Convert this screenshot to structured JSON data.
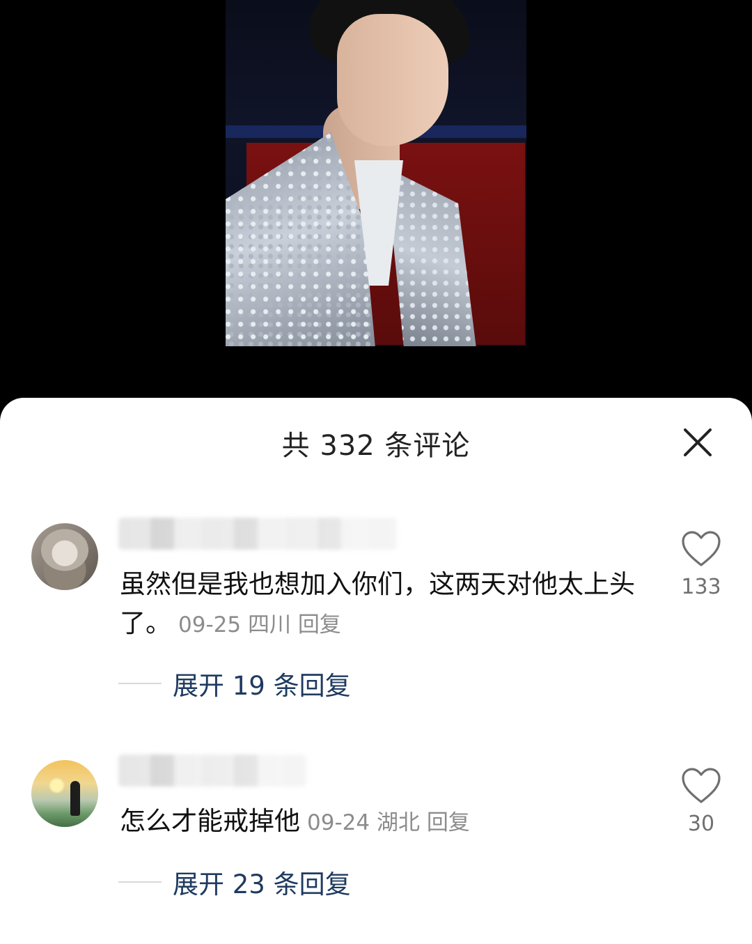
{
  "header": {
    "comment_count": "共 332 条评论"
  },
  "comments": [
    {
      "text": "虽然但是我也想加入你们，这两天对他太上头了。",
      "date": "09-25",
      "location": "四川",
      "reply_label": "回复",
      "likes": "133",
      "expand_label": "展开 19 条回复"
    },
    {
      "text": "怎么才能戒掉他",
      "date": "09-24",
      "location": "湖北",
      "reply_label": "回复",
      "likes": "30",
      "expand_label": "展开 23 条回复"
    }
  ],
  "icons": {
    "close": "close-icon",
    "like": "heart-outline-icon"
  },
  "colors": {
    "expand_link": "#1e3a5f",
    "meta": "#8c8c8c"
  }
}
